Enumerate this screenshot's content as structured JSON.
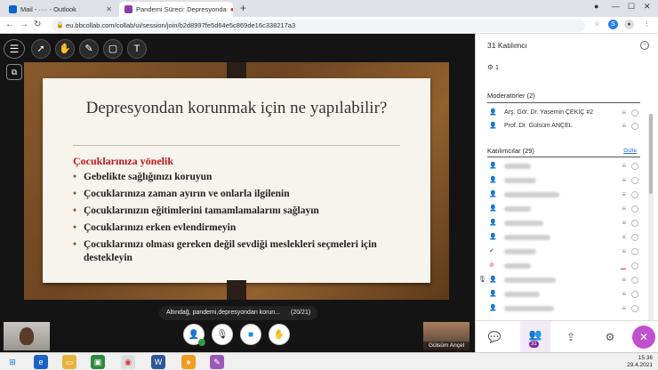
{
  "browser": {
    "tabs": [
      {
        "title": "Mail - ···· - Outlook"
      },
      {
        "title": "Pandemi Süreci: Depresyonda"
      }
    ],
    "new_tab": "+",
    "url": "eu.bbcollab.com/collab/ui/session/join/b2d8997fe5d64e5c869de16c338217a3"
  },
  "toolbar": {
    "icons": [
      "menu-icon",
      "pointer-icon",
      "pan-icon",
      "pen-icon",
      "shape-icon",
      "text-icon"
    ]
  },
  "slide": {
    "title": "Depresyondan korunmak için ne yapılabilir?",
    "subheading": "Çocuklarınıza yönelik",
    "bullets": [
      "Gebelikte sağlığınızı koruyun",
      "Çocuklarınıza zaman ayırın ve onlarla ilgilenin",
      "Çocuklarınızın eğitimlerini tamamlamalarını sağlayın",
      "Çocuklarınızı erken evlendirmeyin",
      "Çocuklarınızı olması gereken değil sevdiği meslekleri seçmeleri için destekleyin"
    ]
  },
  "file_tooltip": {
    "filename": "Altındağ, pandemi,depresyondan korun...",
    "page": "(20/21)"
  },
  "speaker": {
    "name": "Gülsüm Ançel"
  },
  "panel": {
    "title": "31 Katılımcı",
    "hand_count": "1",
    "moderators_heading": "Moderatörler (2)",
    "moderators": [
      "Arş. Gör. Dr. Yasemin ÇEKİÇ #2",
      "Prof. Dr. Gülsüm ANÇEL"
    ],
    "participants_heading": "Katılımcılar (29)",
    "hide_link": "Gizle",
    "participants_badge": "31"
  },
  "taskbar": {
    "time": "15:36",
    "date": "29.4.2021"
  },
  "colors": {
    "accent": "#7c2e9c",
    "slide_red": "#c0161a",
    "wood": "#8a5a2b"
  }
}
